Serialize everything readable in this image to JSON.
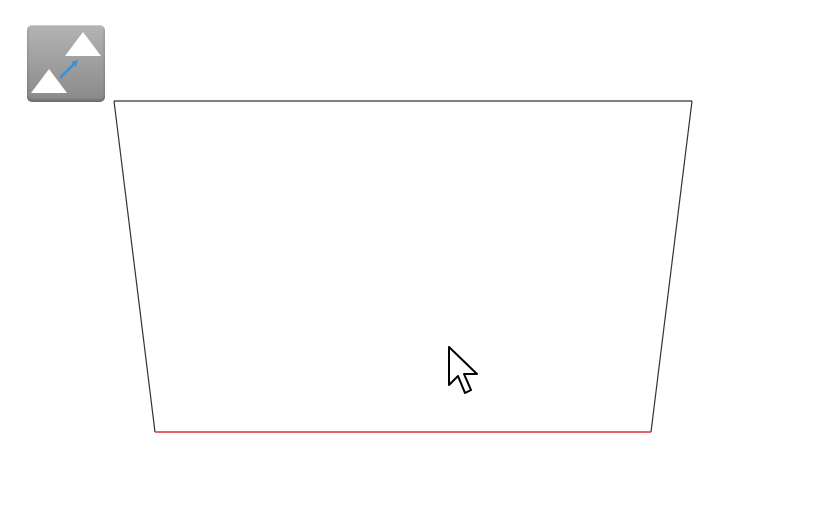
{
  "toolbar": {
    "move_tool": {
      "icon": "move-triangle-icon",
      "accent_color": "#3b8fd9"
    }
  },
  "canvas": {
    "shape": "trapezoid",
    "edge_color": "#333333",
    "selected_edge_color": "#e0303a",
    "selected_edge": "bottom"
  },
  "cursor": {
    "icon": "arrow-cursor-icon"
  }
}
